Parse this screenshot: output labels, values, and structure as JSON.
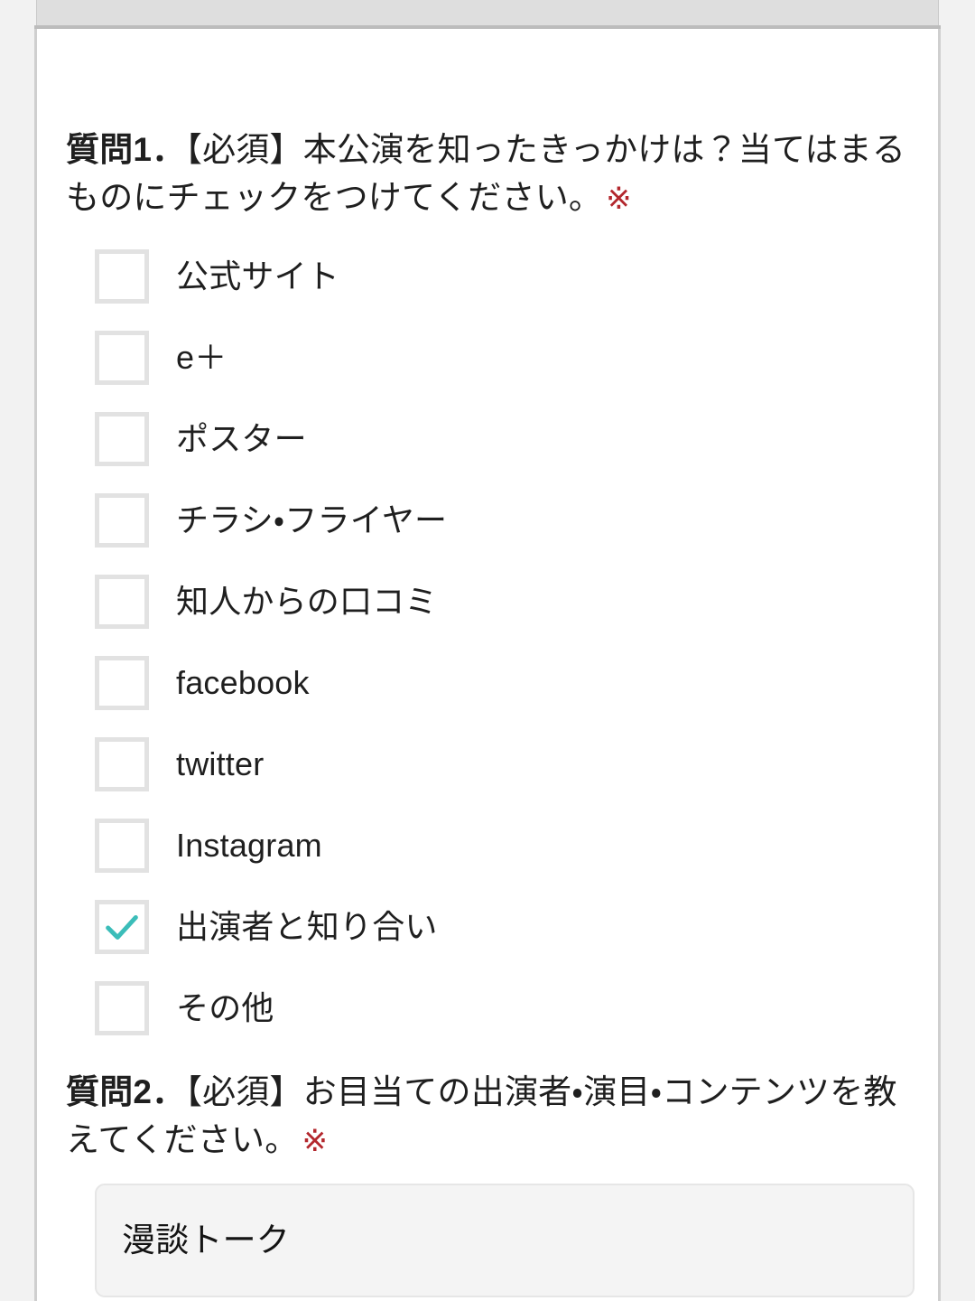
{
  "colors": {
    "page_background": "#f2f2f2",
    "card_background": "#ffffff",
    "top_strip": "#dedede",
    "text": "#1f1f1f",
    "required_mark": "#b3272d",
    "checkbox_border": "#e2e2e2",
    "checkmark": "#3bbdb9",
    "input_background": "#f4f4f4",
    "input_border": "#e6e6e6"
  },
  "questions": [
    {
      "number_label": "質問1．",
      "text": "【必須】本公演を知ったきっかけは？当てはまるものにチェックをつけてください。",
      "required_mark": "※",
      "type": "checkbox",
      "choices": [
        {
          "label": "公式サイト",
          "checked": false
        },
        {
          "label": "e＋",
          "checked": false
        },
        {
          "label": "ポスター",
          "checked": false
        },
        {
          "label": "チラシ・フライヤー",
          "checked": false
        },
        {
          "label": "知人からの口コミ",
          "checked": false
        },
        {
          "label": "facebook",
          "checked": false
        },
        {
          "label": "twitter",
          "checked": false
        },
        {
          "label": "Instagram",
          "checked": false
        },
        {
          "label": "出演者と知り合い",
          "checked": true
        },
        {
          "label": "その他",
          "checked": false
        }
      ]
    },
    {
      "number_label": "質問2．",
      "text": "【必須】お目当ての出演者・演目・コンテンツを教えてください。",
      "required_mark": "※",
      "type": "text",
      "answer": {
        "value": "漫談トーク",
        "placeholder": ""
      }
    }
  ],
  "icons": {
    "checkmark": "check-icon"
  }
}
